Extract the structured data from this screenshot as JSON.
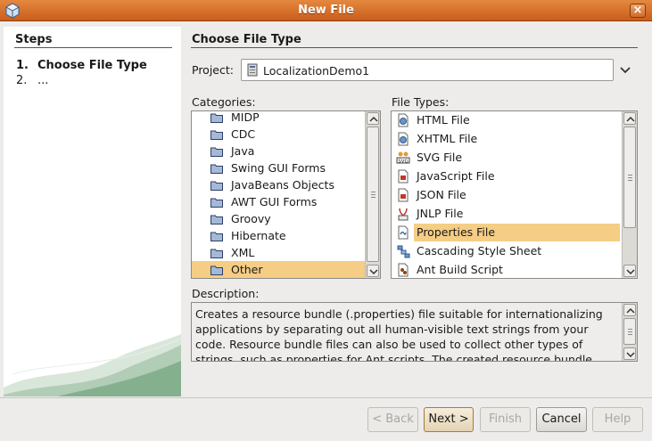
{
  "window": {
    "title": "New File"
  },
  "steps": {
    "title": "Steps",
    "items": [
      {
        "num": "1.",
        "label": "Choose File Type"
      },
      {
        "num": "2.",
        "label": "..."
      }
    ]
  },
  "main": {
    "section_title": "Choose File Type",
    "project_label": "Project:",
    "project_value": "LocalizationDemo1",
    "categories_label": "Categories:",
    "file_types_label": "File Types:",
    "categories": [
      "MIDP",
      "CDC",
      "Java",
      "Swing GUI Forms",
      "JavaBeans Objects",
      "AWT GUI Forms",
      "Groovy",
      "Hibernate",
      "XML",
      "Other"
    ],
    "selected_category": "Other",
    "file_types": [
      {
        "label": "HTML File",
        "icon": "html-file-icon"
      },
      {
        "label": "XHTML File",
        "icon": "xhtml-file-icon"
      },
      {
        "label": "SVG File",
        "icon": "svg-file-icon"
      },
      {
        "label": "JavaScript File",
        "icon": "javascript-file-icon"
      },
      {
        "label": "JSON File",
        "icon": "json-file-icon"
      },
      {
        "label": "JNLP File",
        "icon": "jnlp-file-icon"
      },
      {
        "label": "Properties File",
        "icon": "properties-file-icon"
      },
      {
        "label": "Cascading Style Sheet",
        "icon": "css-file-icon"
      },
      {
        "label": "Ant Build Script",
        "icon": "ant-script-icon"
      }
    ],
    "selected_file_type": "Properties File",
    "description_label": "Description:",
    "description": "Creates a resource bundle (.properties) file suitable for internationalizing applications by separating out all human-visible text strings from your code. Resource bundle files can also be used to collect other types of strings, such as properties for Ant scripts. The created resource bundle"
  },
  "buttons": {
    "back": "< Back",
    "next": "Next >",
    "finish": "Finish",
    "cancel": "Cancel",
    "help": "Help"
  },
  "colors": {
    "titlebar": "#d8722e",
    "selection": "#f5cd85"
  }
}
